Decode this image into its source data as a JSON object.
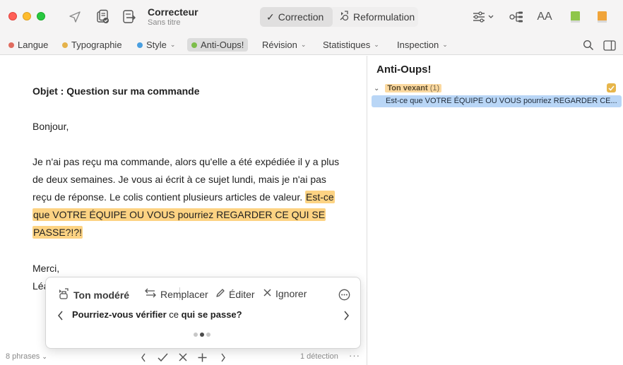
{
  "window": {
    "app_title": "Correcteur",
    "doc_subtitle": "Sans titre"
  },
  "toolbar": {
    "mode_correction": "Correction",
    "mode_reformulation": "Reformulation",
    "font_size_label": "AA"
  },
  "filters": {
    "items": [
      {
        "label": "Langue",
        "color": "#e06c5f"
      },
      {
        "label": "Typographie",
        "color": "#e5b24a"
      },
      {
        "label": "Style",
        "color": "#4a9fe0"
      },
      {
        "label": "Anti-Oups!",
        "color": "#7cbd4a"
      }
    ],
    "menus": [
      "Révision",
      "Statistiques",
      "Inspection"
    ]
  },
  "document": {
    "subject": "Objet : Question sur ma commande",
    "greeting": "Bonjour,",
    "line1": "Je n'ai pas reçu ma commande, alors qu'elle a été expédiée il y a plus",
    "line2": "de deux semaines. Je vous ai écrit à ce sujet lundi, mais je n'ai pas",
    "line3_plain": "reçu de réponse. Le colis contient plusieurs articles de valeur. ",
    "line3_hl": "Est-ce",
    "line4_hl": "que VOTRE ÉQUIPE OU VOUS pourriez REGARDER CE QUI SE",
    "line5_hl": "PASSE?!?!",
    "closing": "Merci,",
    "signature": "Léa"
  },
  "popover": {
    "tone": "Ton modéré",
    "replace": "Remplacer",
    "edit": "Éditer",
    "ignore": "Ignorer",
    "suggestion_bold1": "Pourriez-vous vérifier",
    "suggestion_plain": " ce ",
    "suggestion_bold2": "qui se passe?"
  },
  "bottombar": {
    "phrases": "8 phrases",
    "detections": "1 détection"
  },
  "panel": {
    "title": "Anti-Oups!",
    "group_label": "Ton vexant",
    "group_count": "(1)",
    "item": "Est-ce que VOTRE ÉQUIPE OU VOUS pourriez REGARDER CE..."
  },
  "colors": {
    "highlight": "#fdd383",
    "selection": "#b9d6f6",
    "book_green": "#8fc64a",
    "book_orange": "#f0a43a"
  }
}
